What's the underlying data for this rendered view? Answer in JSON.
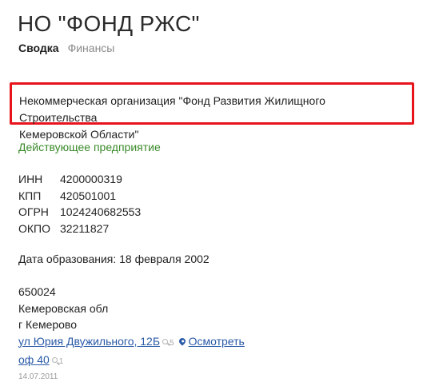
{
  "header": {
    "title": "НО \"ФОНД РЖС\""
  },
  "tabs": [
    {
      "label": "Сводка"
    },
    {
      "label": "Финансы"
    }
  ],
  "organization": {
    "full_name_line1": "Некоммерческая организация \"Фонд Развития Жилищного Строительства",
    "full_name_line2": "Кемеровской Области\"",
    "status": "Действующее предприятие",
    "status_color": "#3a8a2a",
    "highlight_color": "#e8141c"
  },
  "identifiers": [
    {
      "key": "ИНН",
      "value": "4200000319"
    },
    {
      "key": "КПП",
      "value": "420501001"
    },
    {
      "key": "ОГРН",
      "value": "1024240682553"
    },
    {
      "key": "ОКПО",
      "value": "32211827"
    }
  ],
  "founded": "Дата образования: 18 февраля 2002",
  "address": {
    "postcode": "650024",
    "region": "Кемеровская обл",
    "city": "г Кемерово",
    "street": "ул Юрия Двужильного, 12Б",
    "street_count": "5",
    "view_link": "Осмотреть",
    "office": "оф 40",
    "office_count": "1",
    "date": "14.07.2011",
    "link_color": "#2a5aa8"
  },
  "icons": {
    "street_search": "search-icon",
    "map_pin": "map-pin-icon",
    "office_search": "search-icon"
  }
}
